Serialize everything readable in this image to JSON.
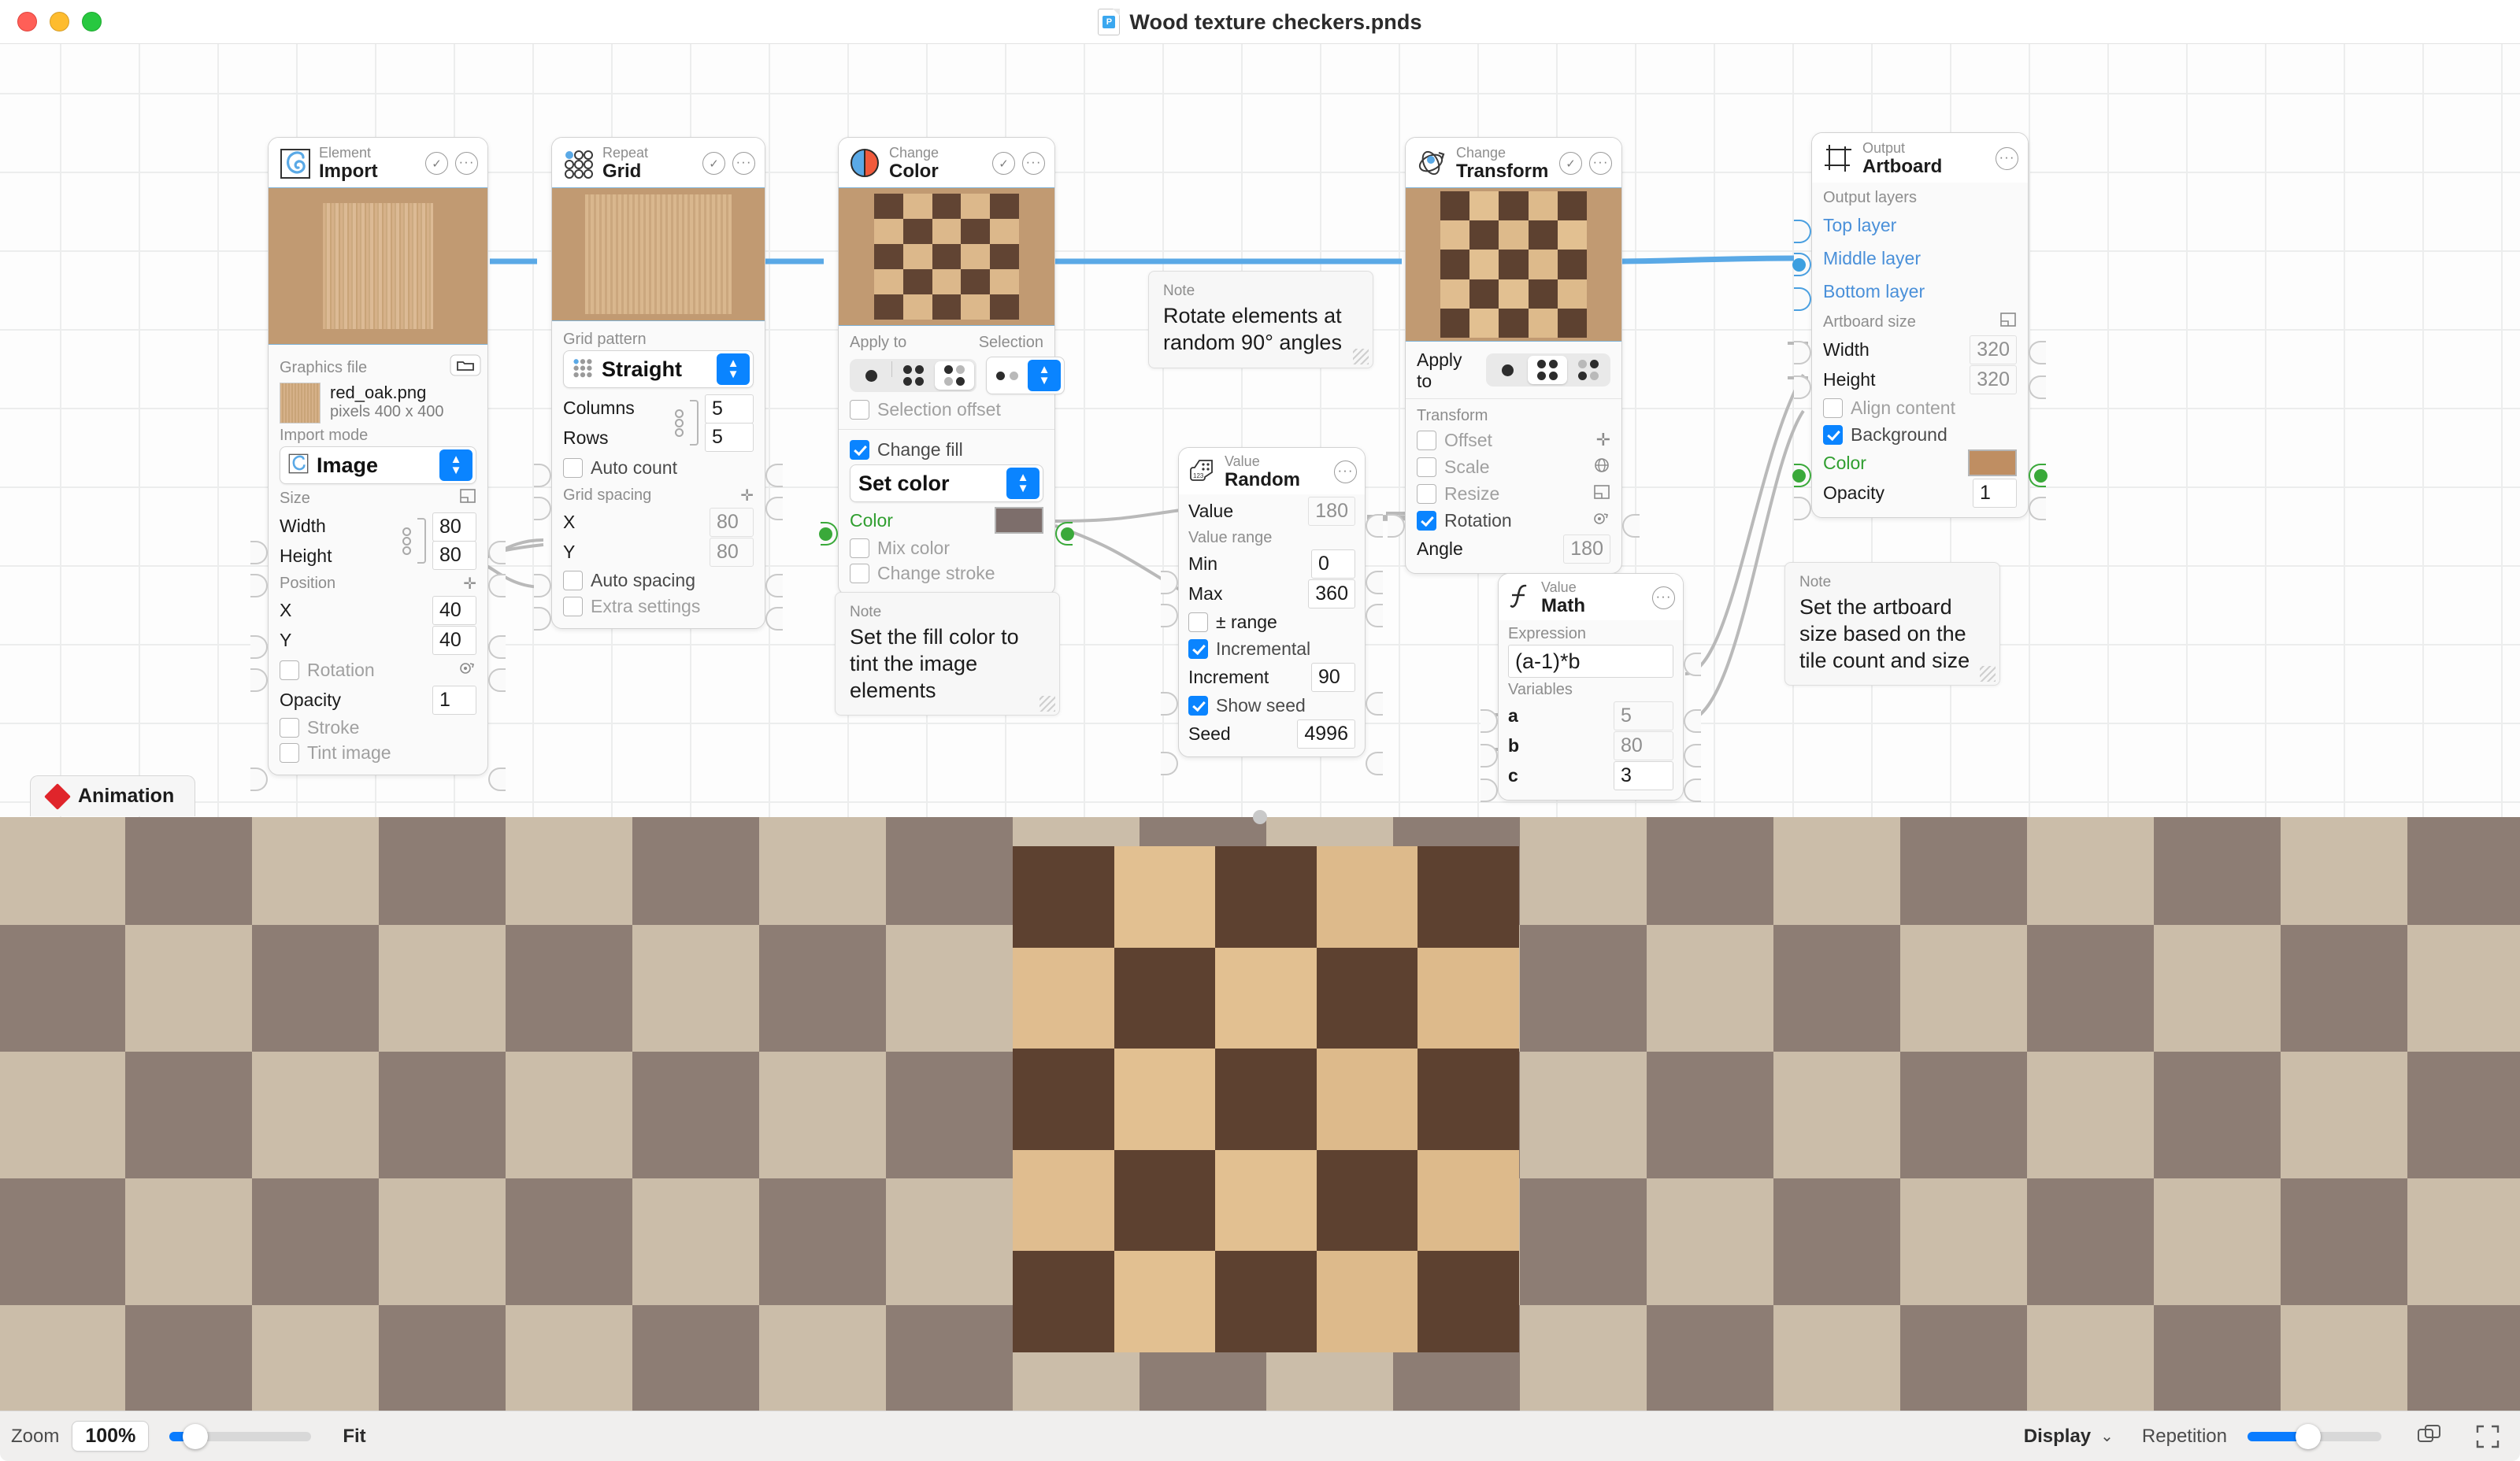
{
  "window": {
    "title": "Wood texture checkers.pnds",
    "file_icon": "document-icon",
    "traffic": {
      "close": "close-button",
      "minimize": "minimize-button",
      "zoom": "zoom-button"
    }
  },
  "nodes": {
    "import": {
      "kind": "Element",
      "name": "Import",
      "icon": "spiral-icon",
      "graphics_file_label": "Graphics file",
      "browse_icon": "folder-icon",
      "file_name": "red_oak.png",
      "file_dimensions": "pixels 400 x 400",
      "import_mode_label": "Import mode",
      "import_mode_value": "Image",
      "size_label": "Size",
      "size_icon": "resize-icon",
      "width_label": "Width",
      "width_value": "80",
      "height_label": "Height",
      "height_value": "80",
      "position_label": "Position",
      "position_icon": "move-icon",
      "x_label": "X",
      "x_value": "40",
      "y_label": "Y",
      "y_value": "40",
      "rotation_label": "Rotation",
      "rotation_icon": "rotate-icon",
      "rotation_checked": false,
      "opacity_label": "Opacity",
      "opacity_value": "1",
      "stroke_label": "Stroke",
      "stroke_checked": false,
      "tint_label": "Tint image",
      "tint_checked": false
    },
    "grid": {
      "kind": "Repeat",
      "name": "Grid",
      "icon": "grid-dots-icon",
      "pattern_label": "Grid pattern",
      "pattern_value": "Straight",
      "columns_label": "Columns",
      "columns_value": "5",
      "rows_label": "Rows",
      "rows_value": "5",
      "auto_count_label": "Auto count",
      "auto_count_checked": false,
      "spacing_label": "Grid spacing",
      "spacing_icon": "move-icon",
      "spacing_x_label": "X",
      "spacing_x_value": "80",
      "spacing_y_label": "Y",
      "spacing_y_value": "80",
      "auto_spacing_label": "Auto spacing",
      "auto_spacing_checked": false,
      "extra_settings_label": "Extra settings",
      "extra_settings_checked": false
    },
    "color": {
      "kind": "Change",
      "name": "Color",
      "icon": "color-circle-icon",
      "apply_to_label": "Apply to",
      "selection_label": "Selection",
      "selection_value": "alternating",
      "selection_offset_label": "Selection offset",
      "selection_offset_checked": false,
      "change_fill_label": "Change fill",
      "change_fill_checked": true,
      "fill_mode_value": "Set color",
      "color_label": "Color",
      "color_swatch": "#7d6e6b",
      "mix_color_label": "Mix color",
      "mix_color_checked": false,
      "change_stroke_label": "Change stroke",
      "change_stroke_checked": false
    },
    "transform": {
      "kind": "Change",
      "name": "Transform",
      "icon": "transform-orbit-icon",
      "apply_to_label": "Apply to",
      "transform_label": "Transform",
      "offset_label": "Offset",
      "offset_checked": false,
      "offset_icon": "move-icon",
      "scale_label": "Scale",
      "scale_checked": false,
      "scale_icon": "globe-icon",
      "resize_label": "Resize",
      "resize_checked": false,
      "resize_icon": "resize-icon",
      "rotation_label": "Rotation",
      "rotation_checked": true,
      "rotation_icon": "rotate-icon",
      "angle_label": "Angle",
      "angle_value": "180"
    },
    "artboard": {
      "kind": "Output",
      "name": "Artboard",
      "icon": "artboard-icon",
      "output_layers_label": "Output layers",
      "layers": [
        "Top layer",
        "Middle layer",
        "Bottom layer"
      ],
      "artboard_size_label": "Artboard size",
      "artboard_size_icon": "resize-icon",
      "width_label": "Width",
      "width_value": "320",
      "height_label": "Height",
      "height_value": "320",
      "align_content_label": "Align content",
      "align_content_checked": false,
      "background_label": "Background",
      "background_checked": true,
      "color_label": "Color",
      "color_swatch": "#bf8e62",
      "opacity_label": "Opacity",
      "opacity_value": "1"
    },
    "random": {
      "kind": "Value",
      "name": "Random",
      "icon": "dice-icon",
      "value_label": "Value",
      "value_value": "180",
      "range_label": "Value range",
      "min_label": "Min",
      "min_value": "0",
      "max_label": "Max",
      "max_value": "360",
      "pm_range_label": "± range",
      "pm_range_checked": false,
      "incremental_label": "Incremental",
      "incremental_checked": true,
      "increment_label": "Increment",
      "increment_value": "90",
      "show_seed_label": "Show seed",
      "show_seed_checked": true,
      "seed_label": "Seed",
      "seed_value": "4996"
    },
    "math": {
      "kind": "Value",
      "name": "Math",
      "icon": "function-icon",
      "expression_label": "Expression",
      "expression_value": "(a-1)*b",
      "variables_label": "Variables",
      "a_label": "a",
      "a_value": "5",
      "b_label": "b",
      "b_value": "80",
      "c_label": "c",
      "c_value": "3"
    }
  },
  "notes": [
    {
      "kind": "Note",
      "text": "Rotate elements at random 90° angles"
    },
    {
      "kind": "Note",
      "text": "Set the fill color to tint the image elements"
    },
    {
      "kind": "Note",
      "text": "Set the artboard size based on the tile count and size"
    }
  ],
  "animation_tab": {
    "label": "Animation",
    "icon": "keyframe-diamond-icon"
  },
  "bottom_bar": {
    "zoom_label": "Zoom",
    "zoom_value": "100%",
    "zoom_slider_pct": 18,
    "fit_label": "Fit",
    "display_label": "Display",
    "display_chevron": "chevron-down-icon",
    "repetition_label": "Repetition",
    "repetition_slider_pct": 45,
    "duplicate_icon": "duplicate-icon",
    "fullscreen_icon": "fullscreen-icon"
  },
  "colors": {
    "accent": "#0a84ff",
    "wire": "#5aa9e6",
    "canvas_grid": "#eceded",
    "artboard_bg": "#bf8e62",
    "tint": "#7d6e6b",
    "wood_light": "#dcb88b",
    "wood_dark": "#614433",
    "tinted_light": "#cbbda9",
    "tinted_dark": "#8d7d74"
  }
}
